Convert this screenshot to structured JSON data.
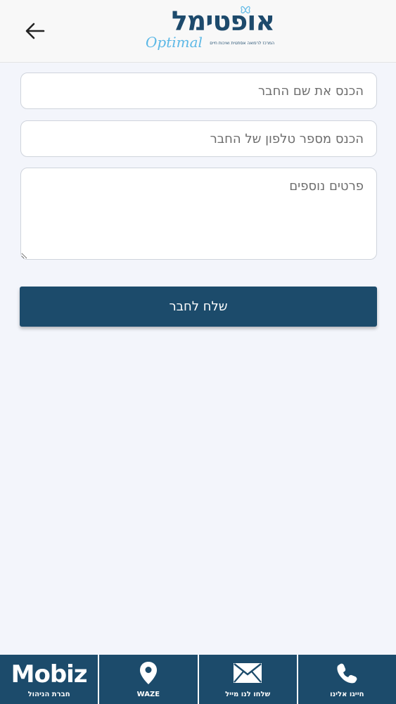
{
  "header": {
    "logo_text": "אופטימל",
    "logo_script": "Optimal",
    "logo_tagline": "המרכז לרפואה אסתטית ואיכות חיים",
    "back_icon": "arrow-left-icon"
  },
  "form": {
    "name_placeholder": "הכנס את שם החבר",
    "phone_placeholder": "הכנס מספר טלפון של החבר",
    "details_placeholder": "פרטים נוספים",
    "submit_label": "שלח לחבר"
  },
  "bottom_nav": {
    "mobiz_word": "Mobiz",
    "mobiz_label": "חברת הניהול",
    "waze_label": "WAZE",
    "mail_label": "שלחו לנו מייל",
    "call_label": "חייגו אלינו"
  },
  "colors": {
    "primary": "#1c4b6b",
    "logo_blue": "#1d4a6c",
    "logo_light_blue": "#5cb8e6",
    "background": "#f3f5fb"
  }
}
